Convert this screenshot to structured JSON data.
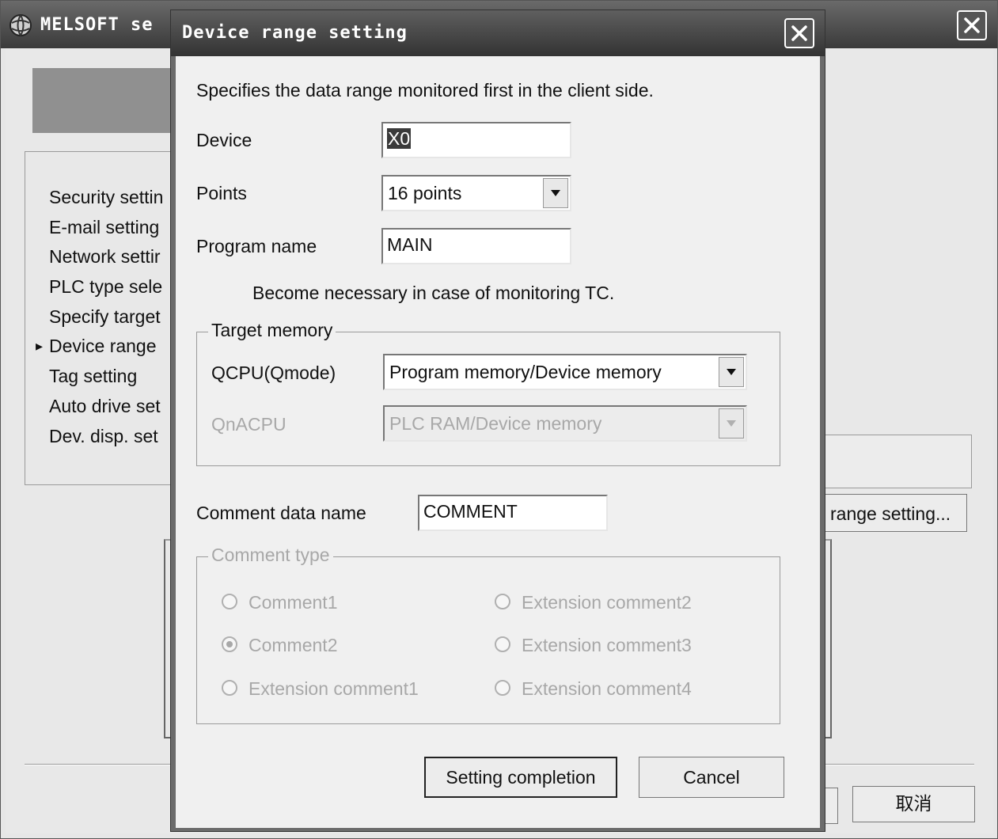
{
  "background_window": {
    "title": "MELSOFT se",
    "menu_items": [
      {
        "label": "Security settin",
        "current": false
      },
      {
        "label": "E-mail setting",
        "current": false
      },
      {
        "label": "Network settir",
        "current": false
      },
      {
        "label": "PLC type sele",
        "current": false
      },
      {
        "label": "Specify target",
        "current": false
      },
      {
        "label": "Device range",
        "current": true
      },
      {
        "label": "Tag setting",
        "current": false
      },
      {
        "label": "Auto drive set",
        "current": false
      },
      {
        "label": "Dev. disp. set",
        "current": false
      }
    ],
    "current_marker": "▸",
    "range_button_label": "range setting...",
    "cancel_button_label": "取消"
  },
  "dialog": {
    "title": "Device range setting",
    "description": "Specifies the data range monitored first in the client side.",
    "device": {
      "label": "Device",
      "value": "X0"
    },
    "points": {
      "label": "Points",
      "value": "16 points"
    },
    "program_name": {
      "label": "Program name",
      "value": "MAIN"
    },
    "tc_note": "Become necessary in case of monitoring TC.",
    "target_memory": {
      "legend": "Target memory",
      "qcpu_label": "QCPU(Qmode)",
      "qcpu_value": "Program memory/Device memory",
      "qnacpu_label": "QnACPU",
      "qnacpu_value": "PLC RAM/Device memory"
    },
    "comment_data_name": {
      "label": "Comment data name",
      "value": "COMMENT"
    },
    "comment_type": {
      "legend": "Comment type",
      "options": [
        {
          "label": "Comment1",
          "selected": false
        },
        {
          "label": "Comment2",
          "selected": true
        },
        {
          "label": "Extension comment1",
          "selected": false
        },
        {
          "label": "Extension comment2",
          "selected": false
        },
        {
          "label": "Extension comment3",
          "selected": false
        },
        {
          "label": "Extension comment4",
          "selected": false
        }
      ]
    },
    "buttons": {
      "ok": "Setting completion",
      "cancel": "Cancel"
    }
  },
  "colors": {
    "titlebar": "#3a3a3a",
    "dialog_face": "#f0f0f0",
    "disabled_text": "#a8a8a8"
  }
}
